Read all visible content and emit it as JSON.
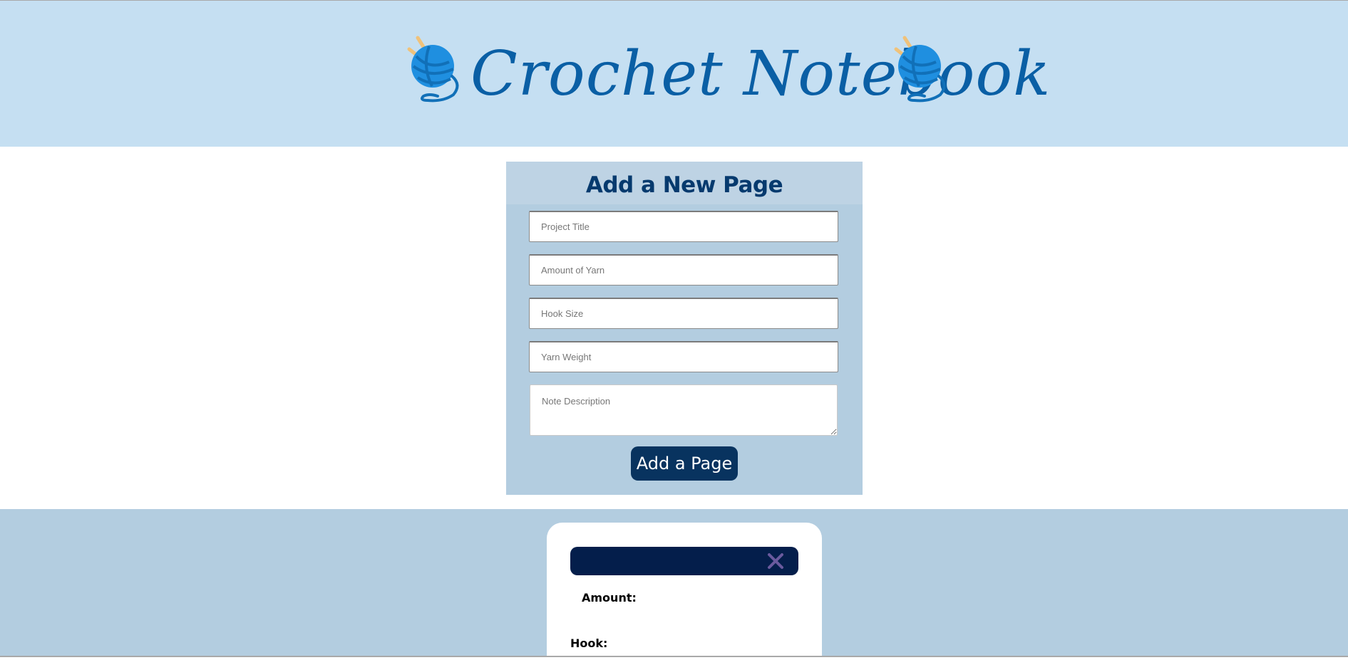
{
  "header": {
    "app_title": "Crochet Notebook",
    "left_icon": "yarn-ball-icon",
    "right_icon": "yarn-ball-icon"
  },
  "form": {
    "heading": "Add a New Page",
    "fields": {
      "project_title": {
        "placeholder": "Project Title",
        "value": ""
      },
      "amount_of_yarn": {
        "placeholder": "Amount of Yarn",
        "value": ""
      },
      "hook_size": {
        "placeholder": "Hook Size",
        "value": ""
      },
      "yarn_weight": {
        "placeholder": "Yarn Weight",
        "value": ""
      },
      "note_description": {
        "placeholder": "Note Description",
        "value": ""
      }
    },
    "submit_label": "Add a Page"
  },
  "note_card": {
    "title": "",
    "close_icon": "close-icon",
    "amount_label": "Amount:",
    "hook_label": "Hook:"
  },
  "colors": {
    "banner_bg": "#c5dff2",
    "title_color": "#0a5fa5",
    "panel_bg": "#b3cde0",
    "heading_color": "#063a6e",
    "button_bg": "#08335f",
    "card_bar_bg": "#041e4b",
    "close_icon_color": "#6a5a9e"
  }
}
